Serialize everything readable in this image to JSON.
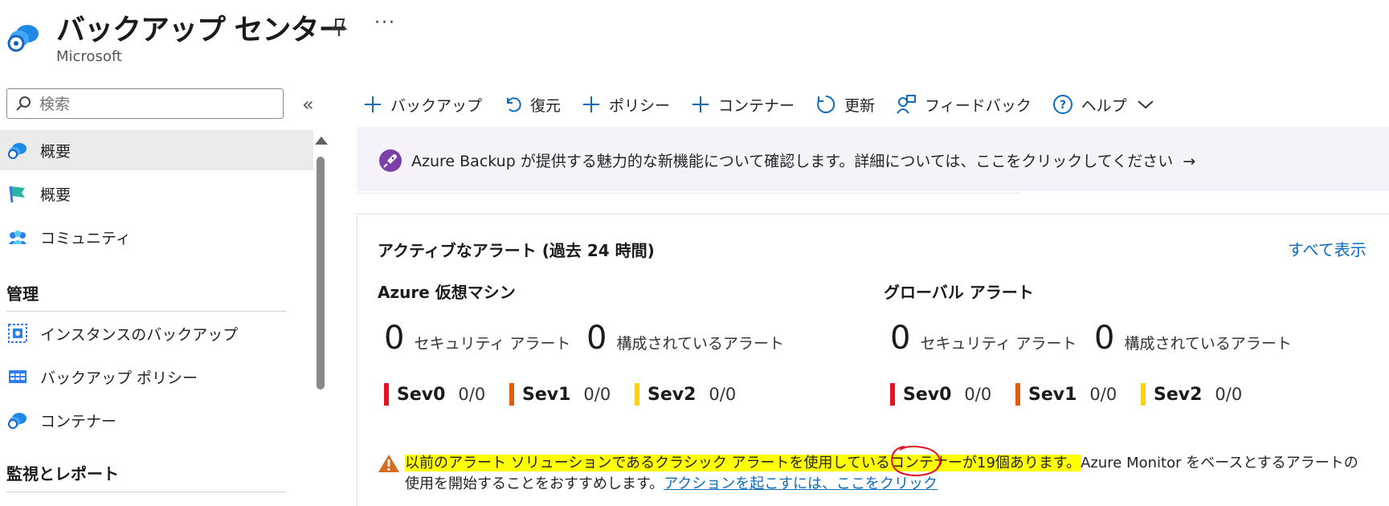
{
  "header": {
    "title": "バックアップ センター",
    "subtitle": "Microsoft",
    "more_label": "···"
  },
  "sidebar": {
    "search_placeholder": "検索",
    "collapse_label": "«",
    "items": [
      {
        "label": "概要",
        "icon": "cloud-backup-icon",
        "active": true
      },
      {
        "label": "概要",
        "icon": "quickstart-flag-icon"
      },
      {
        "label": "コミュニティ",
        "icon": "community-people-icon"
      }
    ],
    "section_manage": "管理",
    "manage_items": [
      {
        "label": "インスタンスのバックアップ",
        "icon": "backup-instances-icon"
      },
      {
        "label": "バックアップ ポリシー",
        "icon": "policy-table-icon"
      },
      {
        "label": "コンテナー",
        "icon": "vault-cloud-icon"
      }
    ],
    "section_monitor": "監視とレポート"
  },
  "toolbar": {
    "backup": "バックアップ",
    "restore": "復元",
    "policy": "ポリシー",
    "vault": "コンテナー",
    "refresh": "更新",
    "feedback": "フィードバック",
    "help": "ヘルプ"
  },
  "banner": {
    "text": "Azure Backup が提供する魅力的な新機能について確認します。詳細については、ここをクリックしてください",
    "arrow": "→"
  },
  "alerts": {
    "title": "アクティブなアラート (過去 24 時間)",
    "see_all": "すべて表示",
    "groups": [
      {
        "title": "Azure 仮想マシン",
        "security_count": "0",
        "security_label": "セキュリティ アラート",
        "configured_count": "0",
        "configured_label": "構成されているアラート",
        "sev": [
          {
            "name": "Sev0",
            "value": "0/0",
            "color": "#e81123"
          },
          {
            "name": "Sev1",
            "value": "0/0",
            "color": "#e05f0f"
          },
          {
            "name": "Sev2",
            "value": "0/0",
            "color": "#fcd116"
          }
        ]
      },
      {
        "title": "グローバル アラート",
        "security_count": "0",
        "security_label": "セキュリティ アラート",
        "configured_count": "0",
        "configured_label": "構成されているアラート",
        "sev": [
          {
            "name": "Sev0",
            "value": "0/0",
            "color": "#e81123"
          },
          {
            "name": "Sev1",
            "value": "0/0",
            "color": "#e05f0f"
          },
          {
            "name": "Sev2",
            "value": "0/0",
            "color": "#fcd116"
          }
        ]
      }
    ],
    "warning": {
      "highlight_text": "以前のアラート ソリューションであるクラシック アラートを使用しているコンテナーが19個あります。",
      "rest_text": "Azure Monitor をベースとするアラートの使用を開始することをおすすめします。",
      "link_text": "アクションを起こすには、ここをクリック"
    }
  }
}
